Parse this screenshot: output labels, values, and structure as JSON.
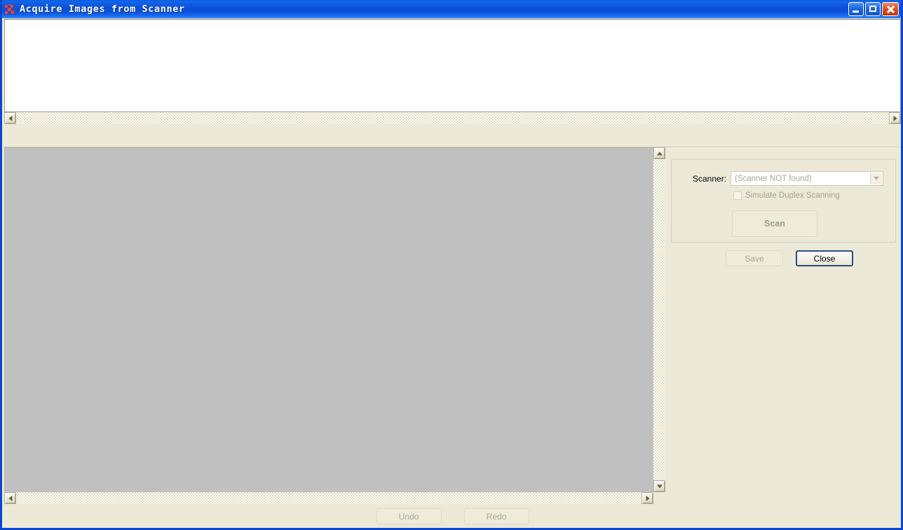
{
  "window": {
    "title": "Acquire Images from Scanner",
    "icon": "app-icon",
    "controls": {
      "minimize": "minimize-icon",
      "maximize": "maximize-icon",
      "close": "close-icon"
    }
  },
  "scrollbars": {
    "thumbnail_left_arrow": "arrow-left-icon",
    "thumbnail_right_arrow": "arrow-right-icon",
    "canvas_up_arrow": "arrow-up-icon",
    "canvas_down_arrow": "arrow-down-icon",
    "canvas_left_arrow": "arrow-left-icon",
    "canvas_right_arrow": "arrow-right-icon"
  },
  "panel": {
    "scanner_label": "Scanner:",
    "scanner_value": "(Scanner NOT found)",
    "scanner_dropdown_icon": "chevron-down-icon",
    "duplex_label": "Simulate Duplex Scanning",
    "duplex_checked": false,
    "scan_label": "Scan",
    "save_label": "Save",
    "close_label": "Close"
  },
  "footer": {
    "undo_label": "Undo",
    "redo_label": "Redo"
  },
  "colors": {
    "titlebar_blue": "#0a50d8",
    "panel_beige": "#ece9d8",
    "canvas_grey": "#c0c0c0",
    "default_button_border": "#2b4d80",
    "disabled_text": "#a9a598"
  }
}
